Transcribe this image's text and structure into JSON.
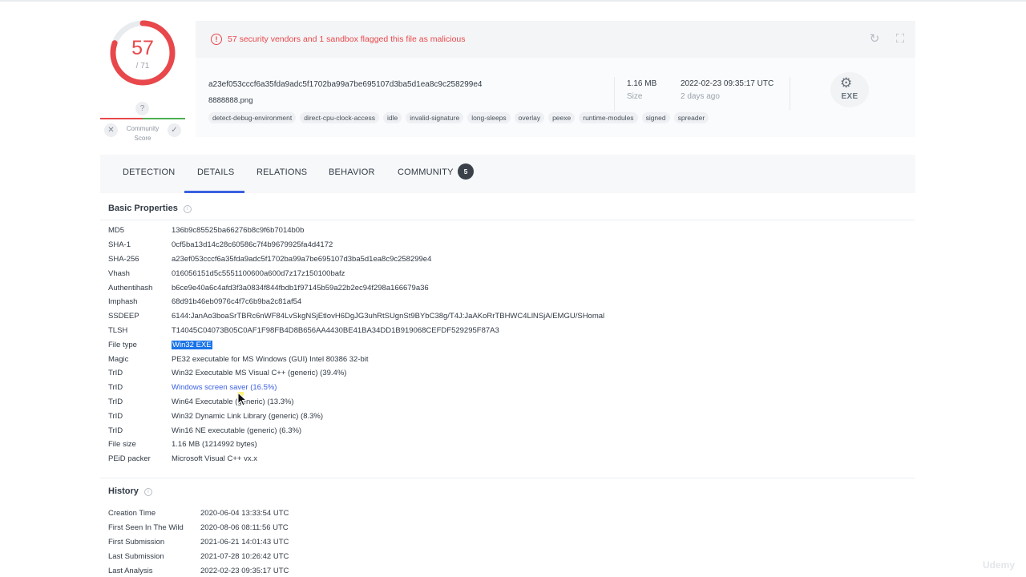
{
  "score": {
    "detections": "57",
    "total": "/ 71",
    "progress": 0.803,
    "colors": {
      "malicious": "#e8484b",
      "track": "#e9ecef"
    }
  },
  "community": {
    "question_icon": "question-icon",
    "label": "Community Score",
    "dislike_icon": "close-icon",
    "like_icon": "check-icon"
  },
  "alert": {
    "icon": "alert-circle-icon",
    "message": "57 security vendors and 1 sandbox flagged this file as malicious",
    "reanalyze_icon": "refresh-icon",
    "similar_icon": "graph-icon"
  },
  "file": {
    "sha256": "a23ef053cccf6a35fda9adc5f1702ba99a7be695107d3ba5d1ea8c9c258299e4",
    "name": "8888888.png",
    "size_value": "1.16 MB",
    "size_label": "Size",
    "date_value": "2022-02-23 09:35:17 UTC",
    "date_label": "2 days ago",
    "type_icon": "exe-file-icon",
    "type_label": "EXE"
  },
  "tags": [
    "detect-debug-environment",
    "direct-cpu-clock-access",
    "idle",
    "invalid-signature",
    "long-sleeps",
    "overlay",
    "peexe",
    "runtime-modules",
    "signed",
    "spreader"
  ],
  "tabs": [
    {
      "label": "DETECTION"
    },
    {
      "label": "DETAILS",
      "active": true
    },
    {
      "label": "RELATIONS"
    },
    {
      "label": "BEHAVIOR"
    },
    {
      "label": "COMMUNITY",
      "badge": "5"
    }
  ],
  "basic": {
    "title": "Basic Properties",
    "info_icon": "info-icon",
    "rows": [
      {
        "key": "MD5",
        "value": "136b9c85525ba66276b8c9f6b7014b0b"
      },
      {
        "key": "SHA-1",
        "value": "0cf5ba13d14c28c60586c7f4b9679925fa4d4172"
      },
      {
        "key": "SHA-256",
        "value": "a23ef053cccf6a35fda9adc5f1702ba99a7be695107d3ba5d1ea8c9c258299e4"
      },
      {
        "key": "Vhash",
        "value": "016056151d5c5551100600a600d7z17z150100bafz"
      },
      {
        "key": "Authentihash",
        "value": "b6ce9e40a6c4afd3f3a0834f844fbdb1f97145b59a22b2ec94f298a166679a36"
      },
      {
        "key": "Imphash",
        "value": "68d91b46eb0976c4f7c6b9ba2c81af54"
      },
      {
        "key": "SSDEEP",
        "value": "6144:JanAo3boaSrTBRc6nWF84LvSkgNSjEtlovH6DgJG3uhRtSUgnSt9BYbC38g/T4J:JaAKoRrTBHWC4LlNSjA/EMGU/SHomal"
      },
      {
        "key": "TLSH",
        "value": "T14045C04073B05C0AF1F98FB4D8B656AA4430BE41BA34DD1B919068CEFDF529295F87A3"
      },
      {
        "key": "File type",
        "value": "Win32 EXE",
        "style": "sel"
      },
      {
        "key": "Magic",
        "value": "PE32 executable for MS Windows (GUI) Intel 80386 32-bit"
      },
      {
        "key": "TrID",
        "value": "Win32 Executable MS Visual C++ (generic) (39.4%)"
      },
      {
        "key": "TrID",
        "value": "Windows screen saver (16.5%)",
        "style": "link"
      },
      {
        "key": "TrID",
        "value": "Win64 Executable (generic) (13.3%)"
      },
      {
        "key": "TrID",
        "value": "Win32 Dynamic Link Library (generic) (8.3%)"
      },
      {
        "key": "TrID",
        "value": "Win16 NE executable (generic) (6.3%)"
      },
      {
        "key": "File size",
        "value": "1.16 MB (1214992 bytes)"
      },
      {
        "key": "PEiD packer",
        "value": "Microsoft Visual C++ vx.x"
      }
    ]
  },
  "history": {
    "title": "History",
    "info_icon": "info-icon",
    "rows": [
      {
        "key": "Creation Time",
        "value": "2020-06-04 13:33:54 UTC"
      },
      {
        "key": "First Seen In The Wild",
        "value": "2020-08-06 08:11:56 UTC"
      },
      {
        "key": "First Submission",
        "value": "2021-06-21 14:01:43 UTC"
      },
      {
        "key": "Last Submission",
        "value": "2021-07-28 10:26:42 UTC"
      },
      {
        "key": "Last Analysis",
        "value": "2022-02-23 09:35:17 UTC"
      }
    ]
  },
  "watermark": "Udemy"
}
